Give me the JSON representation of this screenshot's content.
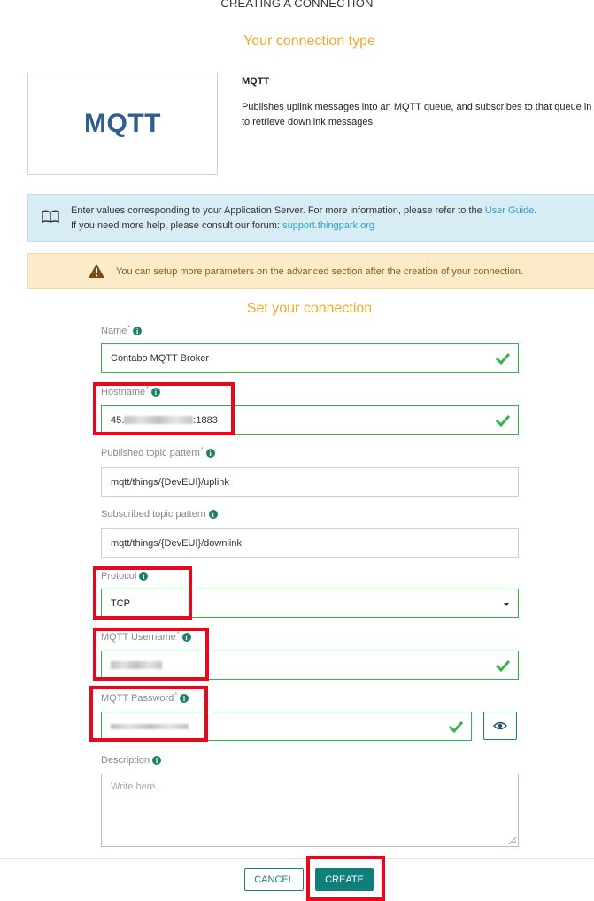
{
  "page_title": "CREATING A CONNECTION",
  "connection_type_heading": "Your connection type",
  "connection": {
    "logo_text": "MQTT",
    "name": "MQTT",
    "description": "Publishes uplink messages into an MQTT queue, and subscribes to that queue in\nto retrieve downlink messages."
  },
  "info_banner": {
    "line1_text": "Enter values corresponding to your Application Server. For more information, please refer to the ",
    "line1_link": "User Guide",
    "line1_end": ".",
    "line2_text": "If you need more help, please consult our forum: ",
    "line2_link": "support.thingpark.org"
  },
  "warning_banner": {
    "text": "You can setup more parameters on the advanced section after the creation of your connection."
  },
  "set_connection_heading": "Set your connection",
  "fields": {
    "name": {
      "label": "Name",
      "value": "Contabo MQTT Broker"
    },
    "hostname": {
      "label": "Hostname",
      "value_prefix": "45.",
      "value_suffix": ":1883"
    },
    "published_topic": {
      "label": "Published topic pattern",
      "value": "mqtt/things/{DevEUI}/uplink"
    },
    "subscribed_topic": {
      "label": "Subscribed topic pattern",
      "value": "mqtt/things/{DevEUI}/downlink"
    },
    "protocol": {
      "label": "Protocol",
      "value": "TCP"
    },
    "mqtt_username": {
      "label": "MQTT Username"
    },
    "mqtt_password": {
      "label": "MQTT Password"
    },
    "description": {
      "label": "Description",
      "placeholder": "Write here..."
    }
  },
  "buttons": {
    "cancel": "CANCEL",
    "create": "CREATE"
  },
  "colors": {
    "accent_orange": "#f0a830",
    "teal": "#0f7f7a",
    "success_green": "#36b24a",
    "highlight_red": "#e8081d",
    "info_bg": "#d7ecf5",
    "warning_bg": "#fcebc9"
  },
  "icons": {
    "info_banner": "book-icon",
    "warning_banner": "warning-triangle-icon",
    "valid": "check-icon",
    "reveal_password": "eye-icon",
    "field_help": "info-icon",
    "select": "caret-down-icon"
  }
}
